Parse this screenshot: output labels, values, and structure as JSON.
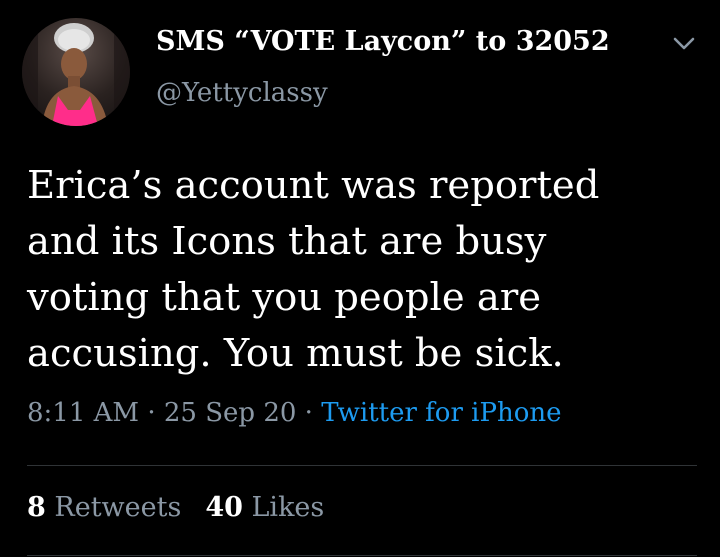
{
  "tweet": {
    "display_name": "SMS “VOTE Laycon” to 32052",
    "handle": "@Yettyclassy",
    "body_lines": [
      "Erica’s account was reported",
      "and its Icons that are busy",
      "voting that you people are",
      "accusing. You must be sick."
    ],
    "time": "8:11 AM",
    "date": "25 Sep 20",
    "separator": " · ",
    "source": "Twitter for iPhone",
    "retweets_count": "8",
    "retweets_label": "Retweets",
    "likes_count": "40",
    "likes_label": "Likes"
  },
  "icons": {
    "menu_caret": "chevron-down-icon"
  },
  "colors": {
    "background": "#000000",
    "text": "#ffffff",
    "secondary": "#8b98a5",
    "link": "#1d9bf0",
    "divider": "#2f3336"
  }
}
